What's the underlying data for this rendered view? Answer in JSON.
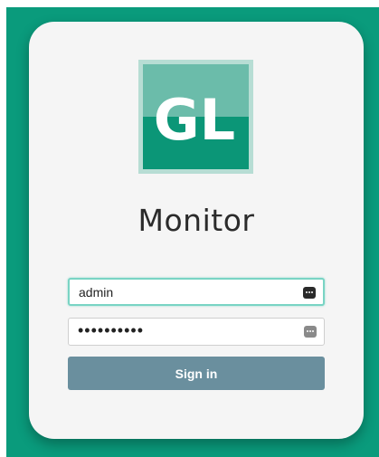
{
  "app": {
    "title": "Monitor"
  },
  "logo": {
    "text": "GL"
  },
  "login": {
    "username_value": "admin",
    "password_value": "••••••••••",
    "signin_label": "Sign in"
  },
  "colors": {
    "background": "#0a9b7c",
    "card": "#f5f5f5",
    "button": "#6a8f9e",
    "logo_top": "#6bbcaa",
    "logo_bottom": "#0b9677",
    "logo_frame": "#b7ddd4",
    "focus_ring": "#79d4c4"
  },
  "icons": {
    "field_icon": "password-manager-key-icon"
  }
}
